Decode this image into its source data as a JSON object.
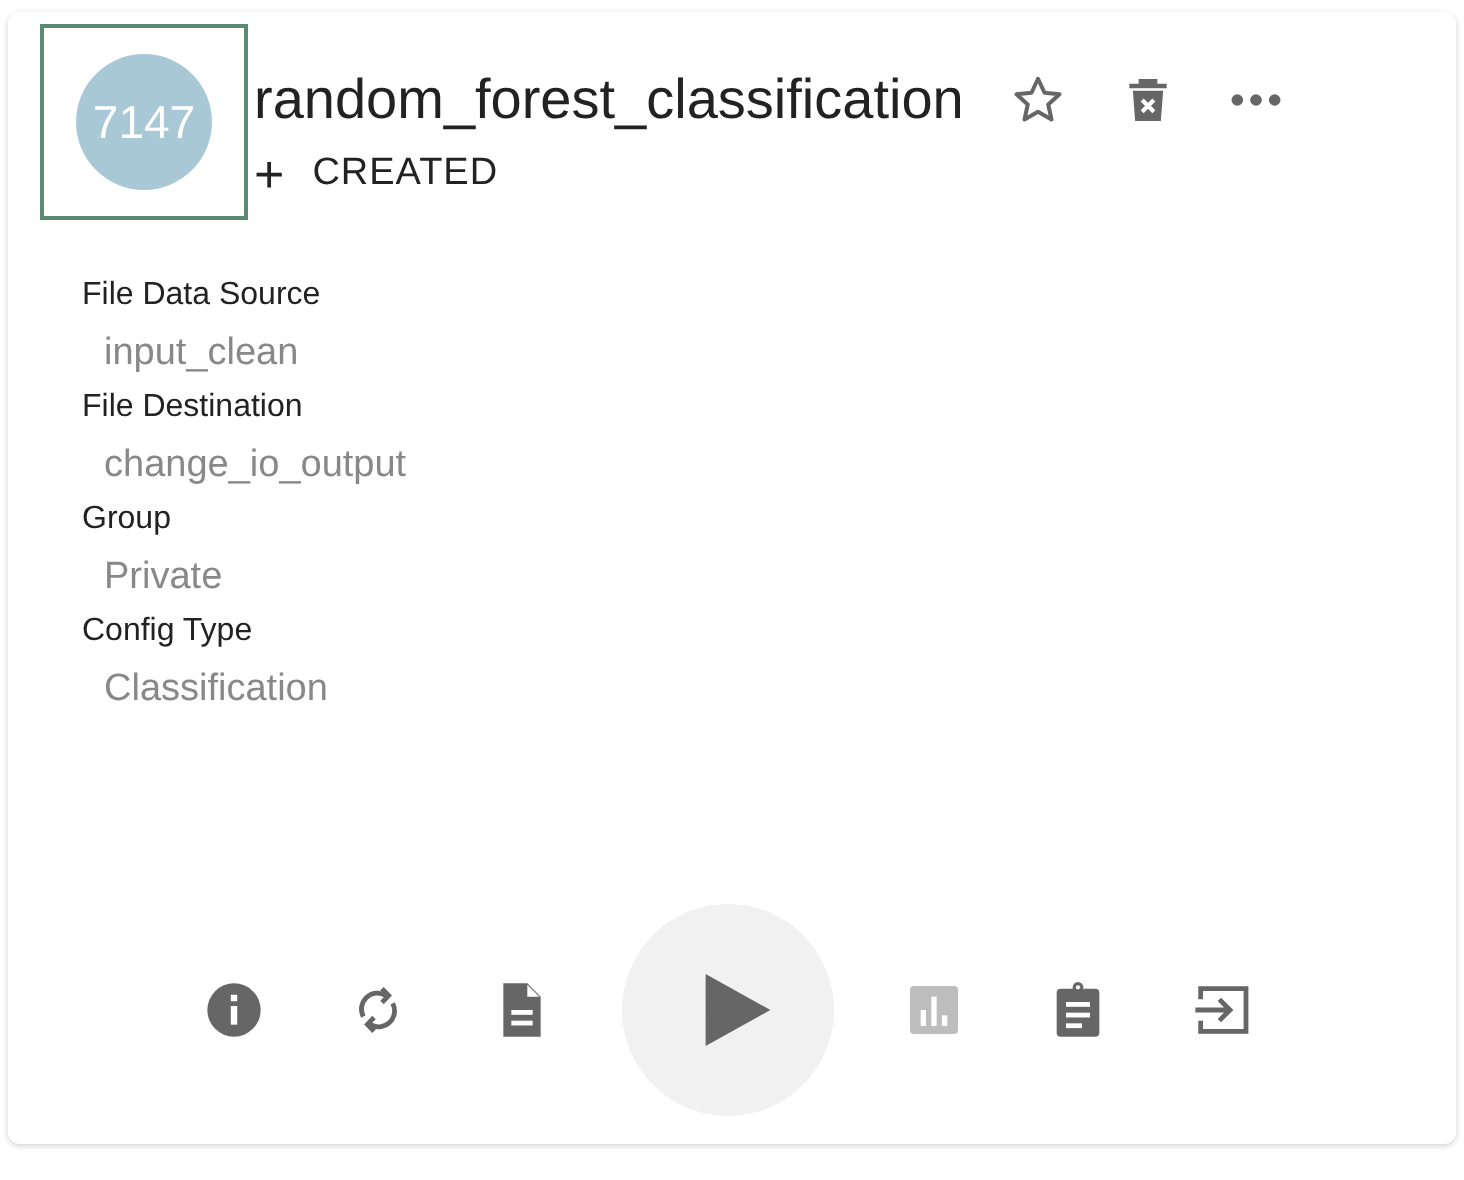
{
  "card": {
    "avatar": {
      "label": "7147",
      "focused": true
    },
    "title": "random_forest_classification",
    "header_actions": [
      {
        "kind": "star"
      },
      {
        "kind": "delete"
      },
      {
        "kind": "more"
      }
    ],
    "status": {
      "icon": "+",
      "label": "CREATED"
    },
    "fields": [
      {
        "label": "File Data Source",
        "value": "input_clean"
      },
      {
        "label": "File Destination",
        "value": "change_io_output"
      },
      {
        "label": "Group",
        "value": "Private"
      },
      {
        "label": "Config Type",
        "value": "Classification"
      }
    ],
    "actions": [
      {
        "kind": "info",
        "disabled": false
      },
      {
        "kind": "refresh",
        "disabled": false
      },
      {
        "kind": "document",
        "disabled": false
      },
      {
        "kind": "play",
        "disabled": false
      },
      {
        "kind": "chart",
        "disabled": true
      },
      {
        "kind": "clipboard",
        "disabled": false
      },
      {
        "kind": "exit",
        "disabled": false
      }
    ]
  }
}
